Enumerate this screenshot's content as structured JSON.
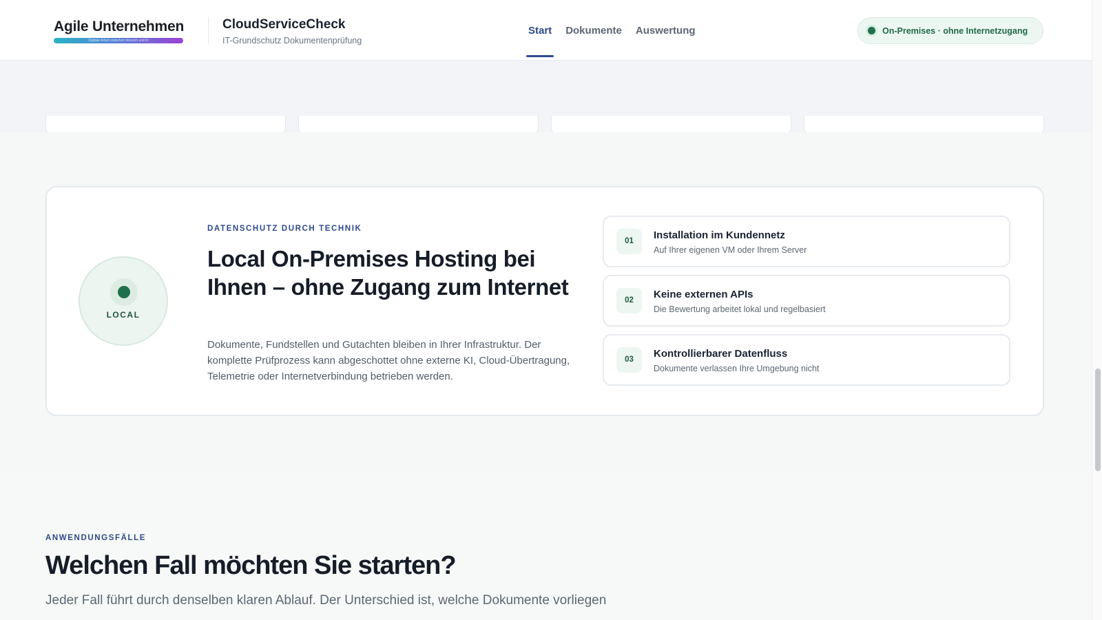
{
  "header": {
    "logo_text": "Agile Unternehmen",
    "logo_tagline": "Digitale Arbeit zwischen Mensch und KI",
    "brand_title": "CloudServiceCheck",
    "brand_subtitle": "IT-Grundschutz Dokumentenprüfung",
    "nav": [
      {
        "label": "Start",
        "active": true
      },
      {
        "label": "Dokumente",
        "active": false
      },
      {
        "label": "Auswertung",
        "active": false
      }
    ],
    "status": "On-Premises · ohne Internetzugang"
  },
  "local_section": {
    "badge_label": "LOCAL",
    "eyebrow": "Datenschutz durch Technik",
    "title": "Local On-Premises Hosting bei Ihnen – ohne Zugang zum Internet",
    "description": "Dokumente, Fundstellen und Gutachten bleiben in Ihrer Infrastruktur. Der komplette Prüfprozess kann abgeschottet ohne externe KI, Cloud-Übertragung, Telemetrie oder Internetverbindung betrieben werden.",
    "steps": [
      {
        "num": "01",
        "title": "Installation im Kundennetz",
        "subtitle": "Auf Ihrer eigenen VM oder Ihrem Server"
      },
      {
        "num": "02",
        "title": "Keine externen APIs",
        "subtitle": "Die Bewertung arbeitet lokal und regelbasiert"
      },
      {
        "num": "03",
        "title": "Kontrollierbarer Datenfluss",
        "subtitle": "Dokumente verlassen Ihre Umgebung nicht"
      }
    ]
  },
  "usecases": {
    "eyebrow": "Anwendungsfälle",
    "title": "Welchen Fall möchten Sie starten?",
    "subtitle": "Jeder Fall führt durch denselben klaren Ablauf. Der Unterschied ist, welche Dokumente vorliegen"
  },
  "colors": {
    "accent_blue": "#2e4a8c",
    "accent_green": "#21704c",
    "status_bg": "#edf7f2"
  }
}
